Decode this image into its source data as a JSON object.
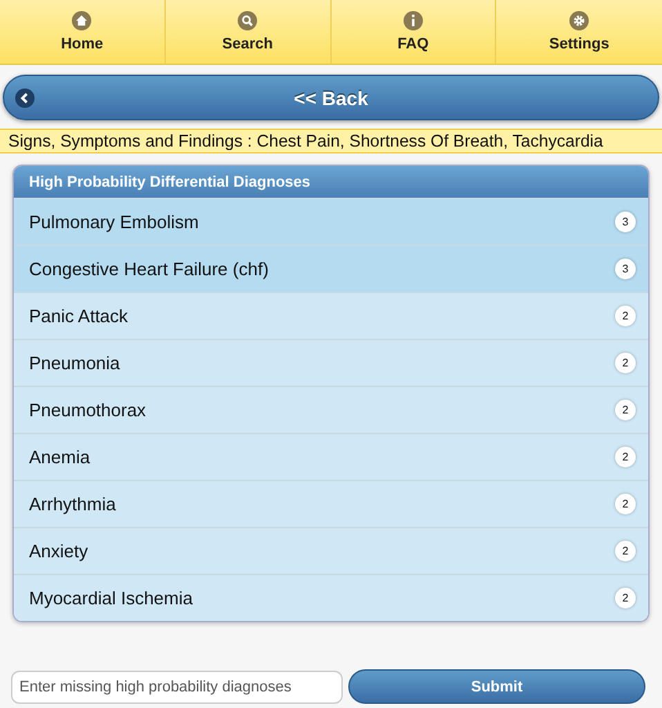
{
  "nav": [
    {
      "label": "Home",
      "kind": "home"
    },
    {
      "label": "Search",
      "kind": "search"
    },
    {
      "label": "FAQ",
      "kind": "info"
    },
    {
      "label": "Settings",
      "kind": "gear"
    }
  ],
  "back_button": {
    "label": "<< Back"
  },
  "findings": "Signs, Symptoms and Findings : Chest Pain, Shortness Of Breath, Tachycardia",
  "list": {
    "title": "High Probability Differential Diagnoses",
    "items": [
      {
        "label": "Pulmonary Embolism",
        "count": "3",
        "highlighted": true
      },
      {
        "label": "Congestive Heart Failure (chf)",
        "count": "3",
        "highlighted": true
      },
      {
        "label": "Panic Attack",
        "count": "2",
        "highlighted": false
      },
      {
        "label": "Pneumonia",
        "count": "2",
        "highlighted": false
      },
      {
        "label": "Pneumothorax",
        "count": "2",
        "highlighted": false
      },
      {
        "label": "Anemia",
        "count": "2",
        "highlighted": false
      },
      {
        "label": "Arrhythmia",
        "count": "2",
        "highlighted": false
      },
      {
        "label": "Anxiety",
        "count": "2",
        "highlighted": false
      },
      {
        "label": "Myocardial Ischemia",
        "count": "2",
        "highlighted": false
      }
    ]
  },
  "form": {
    "placeholder": "Enter missing high probability diagnoses",
    "submit": "Submit"
  }
}
